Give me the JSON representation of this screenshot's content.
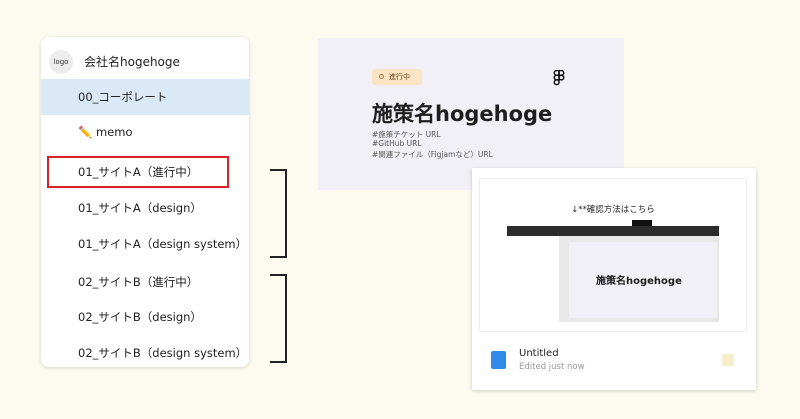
{
  "sidebar": {
    "logo_text": "logo",
    "company_name": "会社名hogehoge",
    "items": [
      {
        "label": "00_コーポレート"
      },
      {
        "label": "✏️ memo"
      },
      {
        "label": "01_サイトA（進行中）"
      },
      {
        "label": "01_サイトA（design）"
      },
      {
        "label": "01_サイトA（design system）"
      },
      {
        "label": "02_サイトB（進行中）"
      },
      {
        "label": "02_サイトB（design）"
      },
      {
        "label": "02_サイトB（design system）"
      }
    ]
  },
  "cover": {
    "badge": "進行中",
    "title": "施策名hogehoge",
    "lines": [
      "#施策チケット URL",
      "#GitHub URL",
      "#関連ファイル（Figjamなど）URL"
    ]
  },
  "file_card": {
    "note": "↓**確認方法はこちら",
    "preview_title": "施策名hogehoge",
    "name": "Untitled",
    "edited": "Edited just now"
  },
  "colors": {
    "background": "#fdfbf0",
    "selected": "#dbe9f6",
    "highlight": "#d9232a",
    "badge": "#fbe4c4",
    "file_icon": "#2f8ae8"
  }
}
